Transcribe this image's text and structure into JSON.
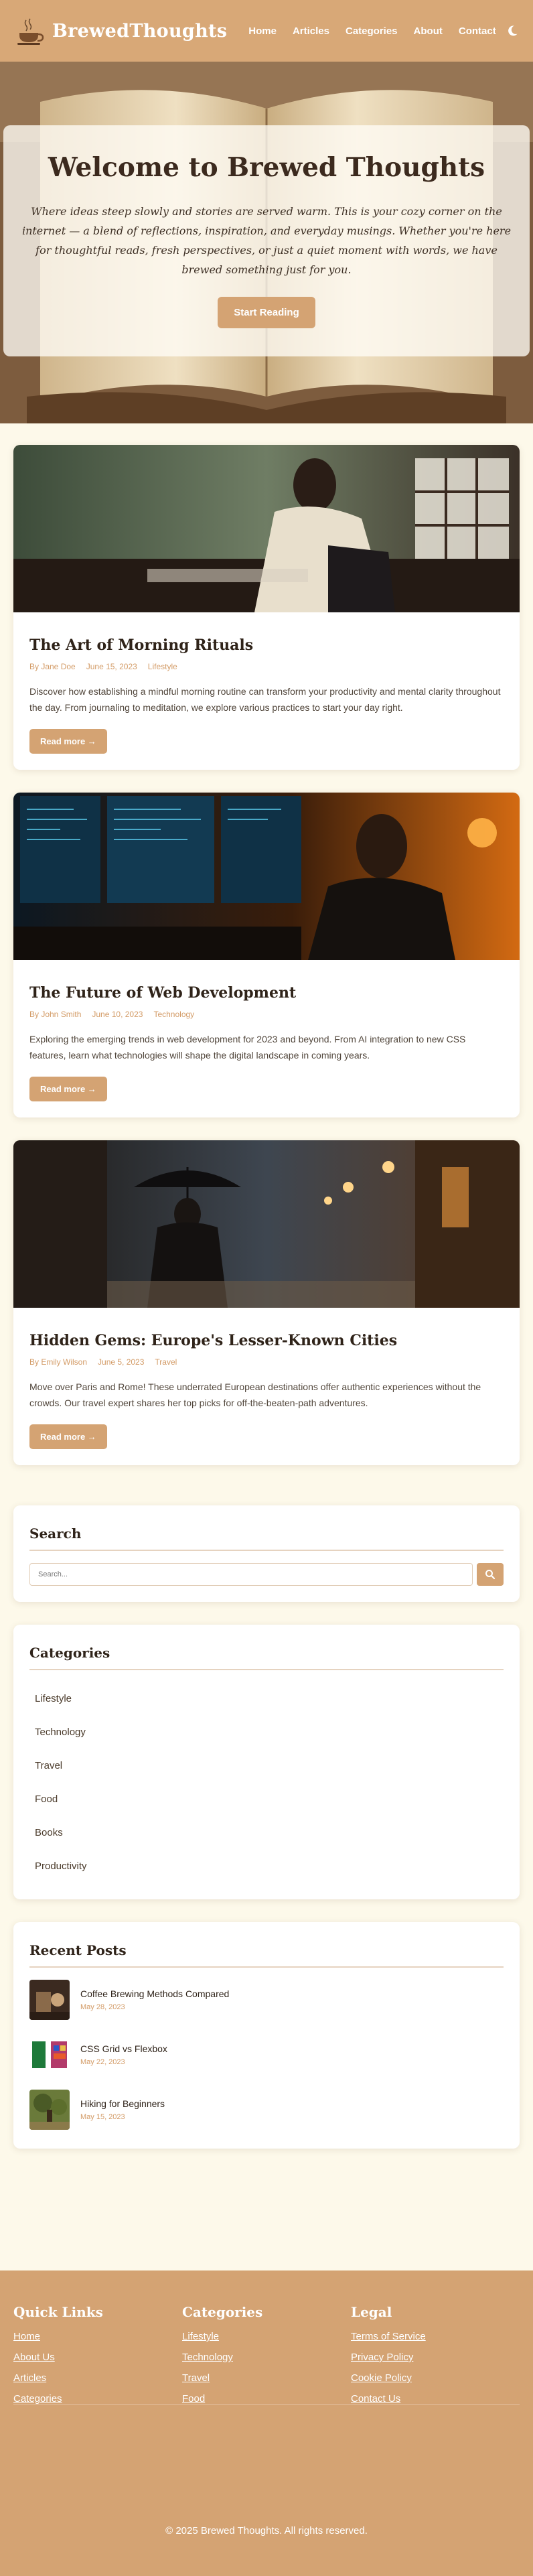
{
  "site": {
    "logo_text": "BrewedThoughts",
    "nav": [
      "Home",
      "Articles",
      "Categories",
      "About",
      "Contact"
    ]
  },
  "hero": {
    "title": "Welcome to Brewed Thoughts",
    "text": "Where ideas steep slowly and stories are served warm. This is your cozy corner on the internet — a blend of reflections, inspiration, and everyday musings. Whether you're here for thoughtful reads, fresh perspectives, or just a quiet moment with words, we have brewed something just for you.",
    "button": "Start Reading"
  },
  "posts": [
    {
      "title": "The Art of Morning Rituals",
      "author": "By Jane Doe",
      "date": "June 15, 2023",
      "category": "Lifestyle",
      "excerpt": "Discover how establishing a mindful morning routine can transform your productivity and mental clarity throughout the day. From journaling to meditation, we explore various practices to start your day right.",
      "button": "Read more →"
    },
    {
      "title": "The Future of Web Development",
      "author": "By John Smith",
      "date": "June 10, 2023",
      "category": "Technology",
      "excerpt": "Exploring the emerging trends in web development for 2023 and beyond. From AI integration to new CSS features, learn what technologies will shape the digital landscape in coming years.",
      "button": "Read more →"
    },
    {
      "title": "Hidden Gems: Europe's Lesser-Known Cities",
      "author": "By Emily Wilson",
      "date": "June 5, 2023",
      "category": "Travel",
      "excerpt": "Move over Paris and Rome! These underrated European destinations offer authentic experiences without the crowds. Our travel expert shares her top picks for off-the-beaten-path adventures.",
      "button": "Read more →"
    }
  ],
  "search": {
    "title": "Search",
    "placeholder": "Search..."
  },
  "categories": {
    "title": "Categories",
    "items": [
      "Lifestyle",
      "Technology",
      "Travel",
      "Food",
      "Books",
      "Productivity"
    ]
  },
  "recent": {
    "title": "Recent Posts",
    "items": [
      {
        "title": "Coffee Brewing Methods Compared",
        "date": "May 28, 2023"
      },
      {
        "title": "CSS Grid vs Flexbox",
        "date": "May 22, 2023"
      },
      {
        "title": "Hiking for Beginners",
        "date": "May 15, 2023"
      }
    ]
  },
  "footer": {
    "quick_links": {
      "title": "Quick Links",
      "items": [
        "Home",
        "About Us",
        "Articles",
        "Categories"
      ]
    },
    "categories": {
      "title": "Categories",
      "items": [
        "Lifestyle",
        "Technology",
        "Travel",
        "Food"
      ]
    },
    "legal": {
      "title": "Legal",
      "items": [
        "Terms of Service",
        "Privacy Policy",
        "Cookie Policy",
        "Contact Us"
      ]
    },
    "copyright": "© 2025 Brewed Thoughts. All rights reserved."
  },
  "colors": {
    "brand": "#d4a373",
    "header": "#d8a877",
    "background": "#fdf9ea",
    "meta_text": "#d39b66"
  }
}
